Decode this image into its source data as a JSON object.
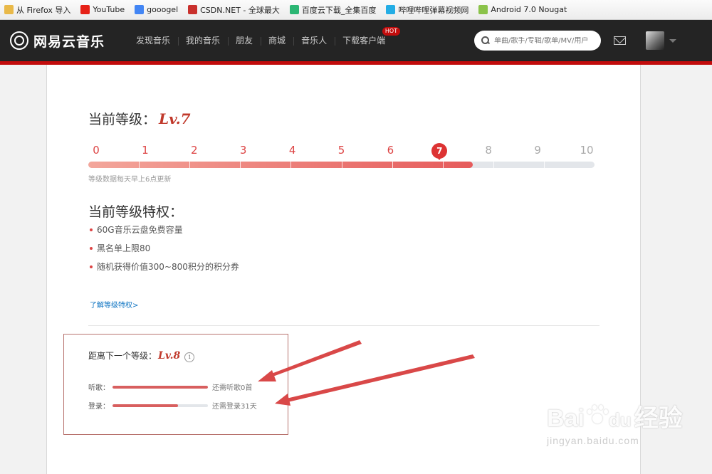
{
  "bookmarks": [
    {
      "label": "从 Firefox 导入",
      "icon": "folder-icon",
      "color": "#e9b949"
    },
    {
      "label": "YouTube",
      "icon": "youtube-icon",
      "color": "#e62117"
    },
    {
      "label": "gooogel",
      "icon": "google-icon",
      "color": "#4285f4"
    },
    {
      "label": "CSDN.NET - 全球最大",
      "icon": "csdn-icon",
      "color": "#c9302c"
    },
    {
      "label": "百度云下载_全集百度",
      "icon": "baidu-cloud-icon",
      "color": "#2bb673"
    },
    {
      "label": "哔哩哔哩弹幕视频网",
      "icon": "bilibili-icon",
      "color": "#23ade5"
    },
    {
      "label": "Android 7.0 Nougat",
      "icon": "android-icon",
      "color": "#8bc34a"
    }
  ],
  "header": {
    "logo_text": "网易云音乐",
    "nav": [
      {
        "label": "发现音乐"
      },
      {
        "label": "我的音乐"
      },
      {
        "label": "朋友"
      },
      {
        "label": "商城"
      },
      {
        "label": "音乐人"
      },
      {
        "label": "下载客户端",
        "badge": "HOT"
      }
    ],
    "search_placeholder": "单曲/歌手/专辑/歌单/MV/用户"
  },
  "level": {
    "title_prefix": "当前等级：",
    "current_label": "Lv.7",
    "current": 7,
    "max": 10,
    "progress": 0.76,
    "numbers": [
      "0",
      "1",
      "2",
      "3",
      "4",
      "5",
      "6",
      "7",
      "8",
      "9",
      "10"
    ],
    "note": "等级数据每天早上6点更新"
  },
  "privileges": {
    "title": "当前等级特权：",
    "items": [
      "60G音乐云盘免费容量",
      "黑名单上限80",
      "随机获得价值300~800积分的积分券"
    ],
    "more_link": "了解等级特权>"
  },
  "next": {
    "title_prefix": "距离下一个等级：",
    "level_label": "Lv.8",
    "info_glyph": "i",
    "rows": [
      {
        "label": "听歌：",
        "progress": 1.0,
        "text": "还需听歌0首"
      },
      {
        "label": "登录：",
        "progress": 0.69,
        "text": "还需登录31天"
      }
    ]
  },
  "watermark": {
    "logo_left": "Bai",
    "logo_right": "经验",
    "paw_letter": "du",
    "sub": "jingyan.baidu.com"
  },
  "colors": {
    "accent": "#c20c0c",
    "level_red": "#d44444",
    "arrow": "#d94848"
  }
}
